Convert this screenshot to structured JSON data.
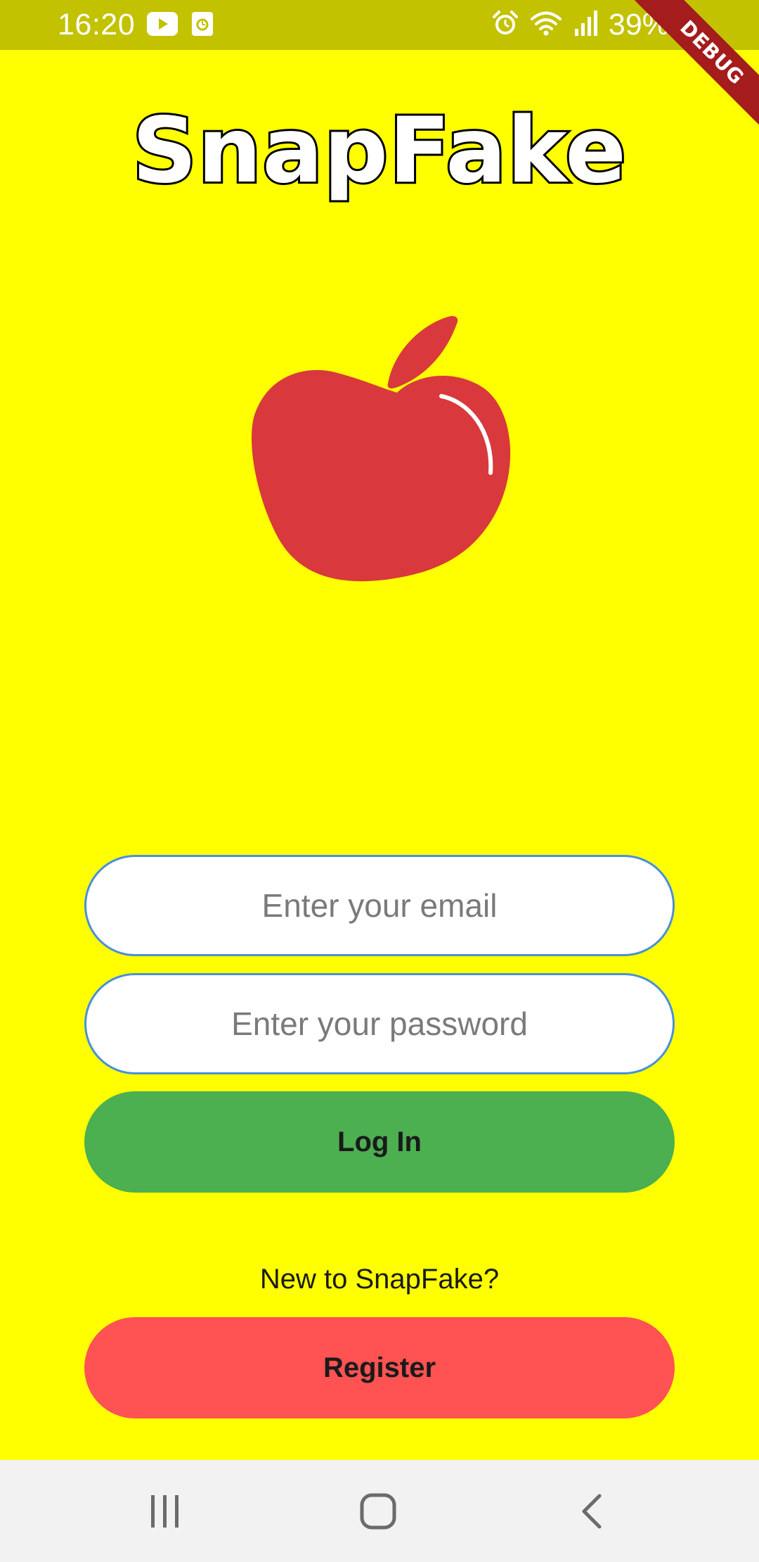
{
  "status_bar": {
    "time": "16:20",
    "battery": "39%",
    "left_icons": [
      "youtube-icon",
      "calendar-notification-icon"
    ],
    "right_icons": [
      "alarm-icon",
      "wifi-icon",
      "signal-icon",
      "battery-icon"
    ]
  },
  "debug_banner": {
    "label": "DEBUG"
  },
  "app": {
    "title": "SnapFake",
    "logo_icon": "apple-icon",
    "logo_color": "#d9393c",
    "background_color": "#ffff00"
  },
  "login_form": {
    "email_placeholder": "Enter your email",
    "email_value": "",
    "password_placeholder": "Enter your password",
    "password_value": "",
    "login_label": "Log In",
    "login_color": "#4caf50",
    "new_user_text": "New to SnapFake?",
    "register_label": "Register",
    "register_color": "#ff5252"
  },
  "nav_bar": {
    "buttons": [
      "recents-icon",
      "home-icon",
      "back-icon"
    ]
  }
}
